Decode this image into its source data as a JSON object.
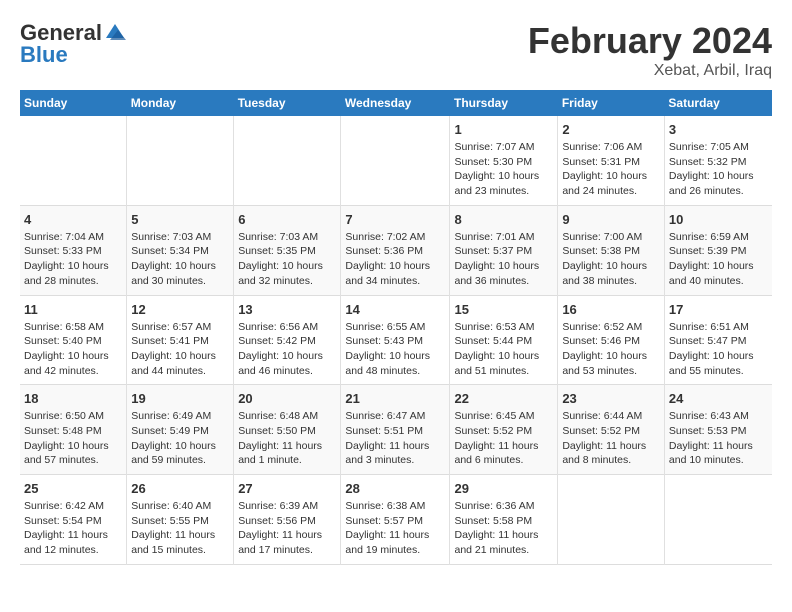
{
  "logo": {
    "general": "General",
    "blue": "Blue"
  },
  "header": {
    "month": "February 2024",
    "location": "Xebat, Arbil, Iraq"
  },
  "weekdays": [
    "Sunday",
    "Monday",
    "Tuesday",
    "Wednesday",
    "Thursday",
    "Friday",
    "Saturday"
  ],
  "weeks": [
    [
      {
        "day": "",
        "info": ""
      },
      {
        "day": "",
        "info": ""
      },
      {
        "day": "",
        "info": ""
      },
      {
        "day": "",
        "info": ""
      },
      {
        "day": "1",
        "info": "Sunrise: 7:07 AM\nSunset: 5:30 PM\nDaylight: 10 hours\nand 23 minutes."
      },
      {
        "day": "2",
        "info": "Sunrise: 7:06 AM\nSunset: 5:31 PM\nDaylight: 10 hours\nand 24 minutes."
      },
      {
        "day": "3",
        "info": "Sunrise: 7:05 AM\nSunset: 5:32 PM\nDaylight: 10 hours\nand 26 minutes."
      }
    ],
    [
      {
        "day": "4",
        "info": "Sunrise: 7:04 AM\nSunset: 5:33 PM\nDaylight: 10 hours\nand 28 minutes."
      },
      {
        "day": "5",
        "info": "Sunrise: 7:03 AM\nSunset: 5:34 PM\nDaylight: 10 hours\nand 30 minutes."
      },
      {
        "day": "6",
        "info": "Sunrise: 7:03 AM\nSunset: 5:35 PM\nDaylight: 10 hours\nand 32 minutes."
      },
      {
        "day": "7",
        "info": "Sunrise: 7:02 AM\nSunset: 5:36 PM\nDaylight: 10 hours\nand 34 minutes."
      },
      {
        "day": "8",
        "info": "Sunrise: 7:01 AM\nSunset: 5:37 PM\nDaylight: 10 hours\nand 36 minutes."
      },
      {
        "day": "9",
        "info": "Sunrise: 7:00 AM\nSunset: 5:38 PM\nDaylight: 10 hours\nand 38 minutes."
      },
      {
        "day": "10",
        "info": "Sunrise: 6:59 AM\nSunset: 5:39 PM\nDaylight: 10 hours\nand 40 minutes."
      }
    ],
    [
      {
        "day": "11",
        "info": "Sunrise: 6:58 AM\nSunset: 5:40 PM\nDaylight: 10 hours\nand 42 minutes."
      },
      {
        "day": "12",
        "info": "Sunrise: 6:57 AM\nSunset: 5:41 PM\nDaylight: 10 hours\nand 44 minutes."
      },
      {
        "day": "13",
        "info": "Sunrise: 6:56 AM\nSunset: 5:42 PM\nDaylight: 10 hours\nand 46 minutes."
      },
      {
        "day": "14",
        "info": "Sunrise: 6:55 AM\nSunset: 5:43 PM\nDaylight: 10 hours\nand 48 minutes."
      },
      {
        "day": "15",
        "info": "Sunrise: 6:53 AM\nSunset: 5:44 PM\nDaylight: 10 hours\nand 51 minutes."
      },
      {
        "day": "16",
        "info": "Sunrise: 6:52 AM\nSunset: 5:46 PM\nDaylight: 10 hours\nand 53 minutes."
      },
      {
        "day": "17",
        "info": "Sunrise: 6:51 AM\nSunset: 5:47 PM\nDaylight: 10 hours\nand 55 minutes."
      }
    ],
    [
      {
        "day": "18",
        "info": "Sunrise: 6:50 AM\nSunset: 5:48 PM\nDaylight: 10 hours\nand 57 minutes."
      },
      {
        "day": "19",
        "info": "Sunrise: 6:49 AM\nSunset: 5:49 PM\nDaylight: 10 hours\nand 59 minutes."
      },
      {
        "day": "20",
        "info": "Sunrise: 6:48 AM\nSunset: 5:50 PM\nDaylight: 11 hours\nand 1 minute."
      },
      {
        "day": "21",
        "info": "Sunrise: 6:47 AM\nSunset: 5:51 PM\nDaylight: 11 hours\nand 3 minutes."
      },
      {
        "day": "22",
        "info": "Sunrise: 6:45 AM\nSunset: 5:52 PM\nDaylight: 11 hours\nand 6 minutes."
      },
      {
        "day": "23",
        "info": "Sunrise: 6:44 AM\nSunset: 5:52 PM\nDaylight: 11 hours\nand 8 minutes."
      },
      {
        "day": "24",
        "info": "Sunrise: 6:43 AM\nSunset: 5:53 PM\nDaylight: 11 hours\nand 10 minutes."
      }
    ],
    [
      {
        "day": "25",
        "info": "Sunrise: 6:42 AM\nSunset: 5:54 PM\nDaylight: 11 hours\nand 12 minutes."
      },
      {
        "day": "26",
        "info": "Sunrise: 6:40 AM\nSunset: 5:55 PM\nDaylight: 11 hours\nand 15 minutes."
      },
      {
        "day": "27",
        "info": "Sunrise: 6:39 AM\nSunset: 5:56 PM\nDaylight: 11 hours\nand 17 minutes."
      },
      {
        "day": "28",
        "info": "Sunrise: 6:38 AM\nSunset: 5:57 PM\nDaylight: 11 hours\nand 19 minutes."
      },
      {
        "day": "29",
        "info": "Sunrise: 6:36 AM\nSunset: 5:58 PM\nDaylight: 11 hours\nand 21 minutes."
      },
      {
        "day": "",
        "info": ""
      },
      {
        "day": "",
        "info": ""
      }
    ]
  ]
}
